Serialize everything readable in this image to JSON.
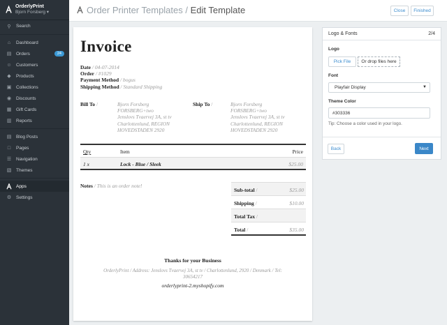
{
  "app": {
    "name": "OrderlyPrint",
    "user": "Bjorn Forsberg ▾"
  },
  "sidebar": {
    "search": "Search",
    "group1": [
      {
        "label": "Dashboard",
        "icon": "home-icon"
      },
      {
        "label": "Orders",
        "icon": "inbox-icon",
        "badge": "24"
      },
      {
        "label": "Customers",
        "icon": "user-icon"
      },
      {
        "label": "Products",
        "icon": "tag-icon"
      },
      {
        "label": "Collections",
        "icon": "collections-icon"
      },
      {
        "label": "Discounts",
        "icon": "discount-icon"
      },
      {
        "label": "Gift Cards",
        "icon": "gift-card-icon"
      },
      {
        "label": "Reports",
        "icon": "reports-icon"
      }
    ],
    "group2": [
      {
        "label": "Blog Posts",
        "icon": "blog-icon"
      },
      {
        "label": "Pages",
        "icon": "pages-icon"
      },
      {
        "label": "Navigation",
        "icon": "navigation-icon"
      },
      {
        "label": "Themes",
        "icon": "themes-icon"
      }
    ],
    "apps": "Apps",
    "settings": "Settings"
  },
  "header": {
    "parent": "Order Printer Templates",
    "separator": "/",
    "current": "Edit Template",
    "close": "Close",
    "finished": "Finished"
  },
  "invoice": {
    "title": "Invoice",
    "date_label": "Date",
    "date_value": "04-07-2014",
    "order_label": "Order",
    "order_value": "#1029",
    "payment_label": "Payment Method",
    "payment_value": "bogus",
    "shipping_label": "Shipping Method",
    "shipping_value": "Standard Shipping",
    "slash": "/",
    "bill_to_label": "Bill To",
    "ship_to_label": "Ship To",
    "bill_to": [
      "Bjorn Forsberg",
      "FORSBERG+two",
      "Jenslovs Tvaervej 3A, st tv",
      "Charlottenlund, REGION",
      "HOVEDSTADEN 2920"
    ],
    "ship_to": [
      "Bjorn Forsberg",
      "FORSBERG+two",
      "Jenslovs Tvaervej 3A, st tv",
      "Charlottenlund, REGION",
      "HOVEDSTADEN 2920"
    ],
    "col_qty": "Qty",
    "col_item": "Item",
    "col_price": "Price",
    "line_qty": "1 x",
    "line_item": "Lock - Blue / Sleek",
    "line_price": "$25.00",
    "notes_label": "Notes",
    "notes_value": "This is an order note!",
    "subtotal_label": "Sub-total",
    "subtotal_value": "$25.00",
    "shipping_total_label": "Shipping",
    "shipping_total_value": "$10.00",
    "tax_label": "Total Tax",
    "total_label": "Total",
    "total_value": "$35.00",
    "thanks": "Thanks for your Business",
    "address_line1": "OrderlyPrint / Address: Jenslovs Tvaervej 3A, st tv / Charlottenlund, 2920 / Denmark / Tel:",
    "address_line2": "30654217",
    "website": "orderlyprint-2.myshopify.com"
  },
  "panel": {
    "title": "Logo & Fonts",
    "step": "2/4",
    "logo_label": "Logo",
    "pick_file": "Pick File",
    "drop_text": "Or drop files here",
    "font_label": "Font",
    "font_value": "Playfair Display",
    "theme_color_label": "Theme Color",
    "theme_color_value": "#303336",
    "tip": "Tip: Choose a color used in your logo.",
    "back": "Back",
    "next": "Next"
  },
  "colors": {
    "sidebar_bg": "#2b3239",
    "accent": "#3a87c8",
    "badge": "#3c9ad6"
  }
}
